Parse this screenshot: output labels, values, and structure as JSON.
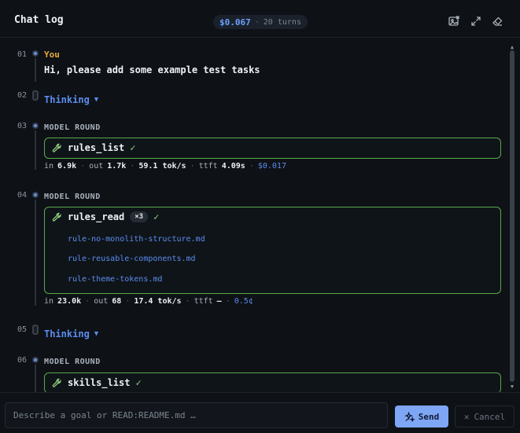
{
  "header": {
    "title": "Chat log",
    "cost": "$0.067",
    "turns": "20 turns",
    "icons": [
      "image-export-icon",
      "expand-icon",
      "eraser-icon"
    ]
  },
  "rows": {
    "r1": {
      "num": "01",
      "speaker": "You",
      "message": "Hi, please add some example test tasks"
    },
    "r2": {
      "num": "02",
      "label": "Thinking"
    },
    "r3": {
      "num": "03",
      "label": "MODEL ROUND",
      "tool": "rules_list",
      "metrics": {
        "in_label": "in",
        "in": "6.9k",
        "out_label": "out",
        "out": "1.7k",
        "rate": "59.1 tok/s",
        "ttft_label": "ttft",
        "ttft": "4.09s",
        "cost": "$0.017"
      }
    },
    "r4": {
      "num": "04",
      "label": "MODEL ROUND",
      "tool": "rules_read",
      "count": "×3",
      "files": [
        "rule-no-monolith-structure.md",
        "rule-reusable-components.md",
        "rule-theme-tokens.md"
      ],
      "metrics": {
        "in_label": "in",
        "in": "23.0k",
        "out_label": "out",
        "out": "68",
        "rate": "17.4 tok/s",
        "ttft_label": "ttft",
        "ttft": "—",
        "cost": "0.5¢"
      }
    },
    "r5": {
      "num": "05",
      "label": "Thinking"
    },
    "r6": {
      "num": "06",
      "label": "MODEL ROUND",
      "tool": "skills_list"
    }
  },
  "footer": {
    "placeholder": "Describe a goal or READ:README.md …",
    "send_label": "Send",
    "cancel_label": "Cancel"
  },
  "colors": {
    "accent": "#5b8dee",
    "you": "#e8a93b",
    "tool_border": "#58a94b",
    "send_bg": "#7fa6f5"
  }
}
